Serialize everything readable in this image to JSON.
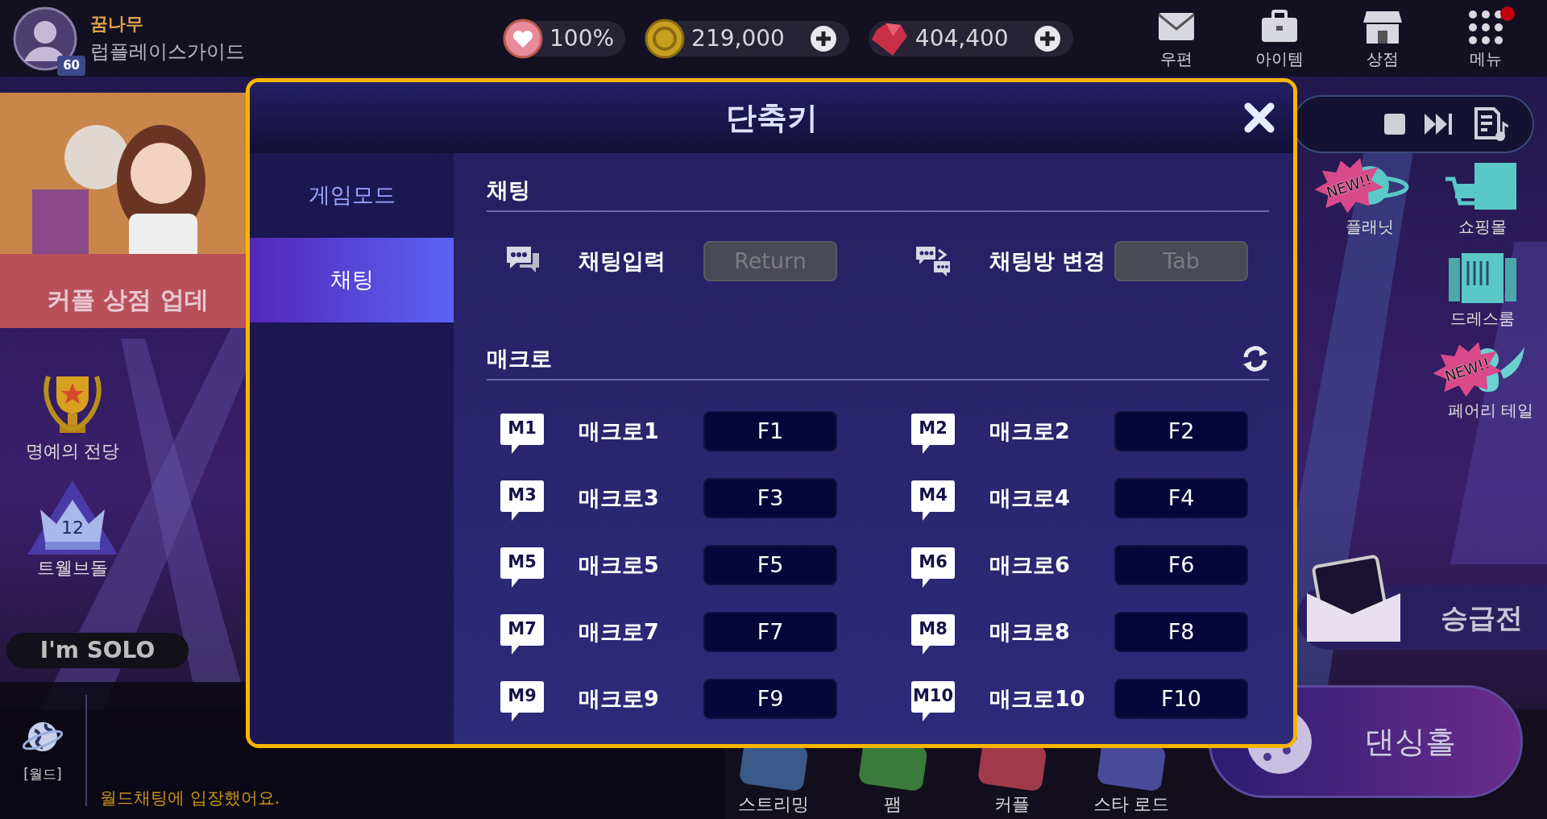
{
  "profile": {
    "name": "꿈나무",
    "title": "럽플레이스가이드",
    "rank": "60"
  },
  "currencies": [
    {
      "kind": "heart",
      "amount": "100%",
      "plus": false
    },
    {
      "kind": "gold",
      "amount": "219,000",
      "plus": true
    },
    {
      "kind": "ruby",
      "amount": "404,400",
      "plus": true
    }
  ],
  "top_menu": [
    {
      "kind": "mail",
      "label": "우편",
      "alert": false
    },
    {
      "kind": "bag",
      "label": "아이템",
      "alert": false
    },
    {
      "kind": "shop",
      "label": "상점",
      "alert": false
    },
    {
      "kind": "menu",
      "label": "메뉴",
      "alert": true
    }
  ],
  "banner": {
    "text": "커플 상점 업데"
  },
  "left_menu": [
    {
      "kind": "trophy",
      "label": "명예의 전당"
    },
    {
      "kind": "crown",
      "label": "트웰브돌",
      "number": "12"
    }
  ],
  "solo_tag": "I'm SOLO",
  "chat": {
    "channel": "[월드]",
    "message": "월드채팅에 입장했어요."
  },
  "right_menu": [
    {
      "kind": "planet",
      "label": "플래닛",
      "badge": "NEW!!"
    },
    {
      "kind": "mall",
      "label": "쇼핑몰"
    },
    {
      "kind": "dressroom",
      "label": "드레스룸"
    },
    {
      "kind": "fairy",
      "label": "페어리 테일",
      "badge": "NEW!!"
    }
  ],
  "promotion": {
    "label": "승급전"
  },
  "bottom_nav": [
    {
      "kind": "streaming",
      "label": "스트리밍"
    },
    {
      "kind": "fam",
      "label": "팸"
    },
    {
      "kind": "couple",
      "label": "커플"
    },
    {
      "kind": "starroad",
      "label": "스타 로드"
    }
  ],
  "dance_hall": {
    "label": "댄싱홀"
  },
  "dialog": {
    "title": "단축키",
    "tabs": [
      {
        "label": "게임모드",
        "selected": false
      },
      {
        "label": "채팅",
        "selected": true
      }
    ],
    "sections": [
      {
        "title": "채팅",
        "refresh": false,
        "items": [
          {
            "kind": "chat",
            "label": "채팅입력",
            "key": "Return",
            "disabled": true
          },
          {
            "kind": "chat-switch",
            "label": "채팅방 변경",
            "key": "Tab",
            "disabled": true
          }
        ]
      },
      {
        "title": "매크로",
        "refresh": true,
        "items": [
          {
            "kind": "macro",
            "badge": "M1",
            "label": "매크로1",
            "key": "F1",
            "disabled": false
          },
          {
            "kind": "macro",
            "badge": "M2",
            "label": "매크로2",
            "key": "F2",
            "disabled": false
          },
          {
            "kind": "macro",
            "badge": "M3",
            "label": "매크로3",
            "key": "F3",
            "disabled": false
          },
          {
            "kind": "macro",
            "badge": "M4",
            "label": "매크로4",
            "key": "F4",
            "disabled": false
          },
          {
            "kind": "macro",
            "badge": "M5",
            "label": "매크로5",
            "key": "F5",
            "disabled": false
          },
          {
            "kind": "macro",
            "badge": "M6",
            "label": "매크로6",
            "key": "F6",
            "disabled": false
          },
          {
            "kind": "macro",
            "badge": "M7",
            "label": "매크로7",
            "key": "F7",
            "disabled": false
          },
          {
            "kind": "macro",
            "badge": "M8",
            "label": "매크로8",
            "key": "F8",
            "disabled": false
          },
          {
            "kind": "macro",
            "badge": "M9",
            "label": "매크로9",
            "key": "F9",
            "disabled": false
          },
          {
            "kind": "macro",
            "badge": "M10",
            "label": "매크로10",
            "key": "F10",
            "disabled": false
          }
        ]
      }
    ]
  }
}
